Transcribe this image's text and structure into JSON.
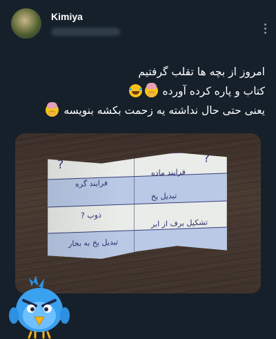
{
  "author": {
    "name": "Kimiya"
  },
  "tweet": {
    "lines": [
      "امروز از بچه ها تقلب گرفتیم",
      "کتاب و پاره کرده آورده",
      "یعنی حتی حال نداشته یه زحمت بکشه بنویسه"
    ]
  },
  "photo": {
    "paper_text": {
      "top_right": "فرایند ماده",
      "top_left": "فرایند گره",
      "mid_right": "تبدیل یخ",
      "mid_left": "ذوب ?",
      "bot_right": "تشکیل برف از ابر",
      "bot_left": "تبدیل یخ به بخار",
      "question_marks": "?"
    }
  },
  "icons": {
    "more": "more-vertical-icon",
    "emoji_facepalm": "woman-facepalming-emoji",
    "emoji_laugh": "face-with-tears-of-joy-emoji",
    "mascot": "angry-blue-bird-sticker"
  },
  "colors": {
    "background": "#15202b",
    "text": "#ffffff",
    "muted": "#8b98a5"
  }
}
